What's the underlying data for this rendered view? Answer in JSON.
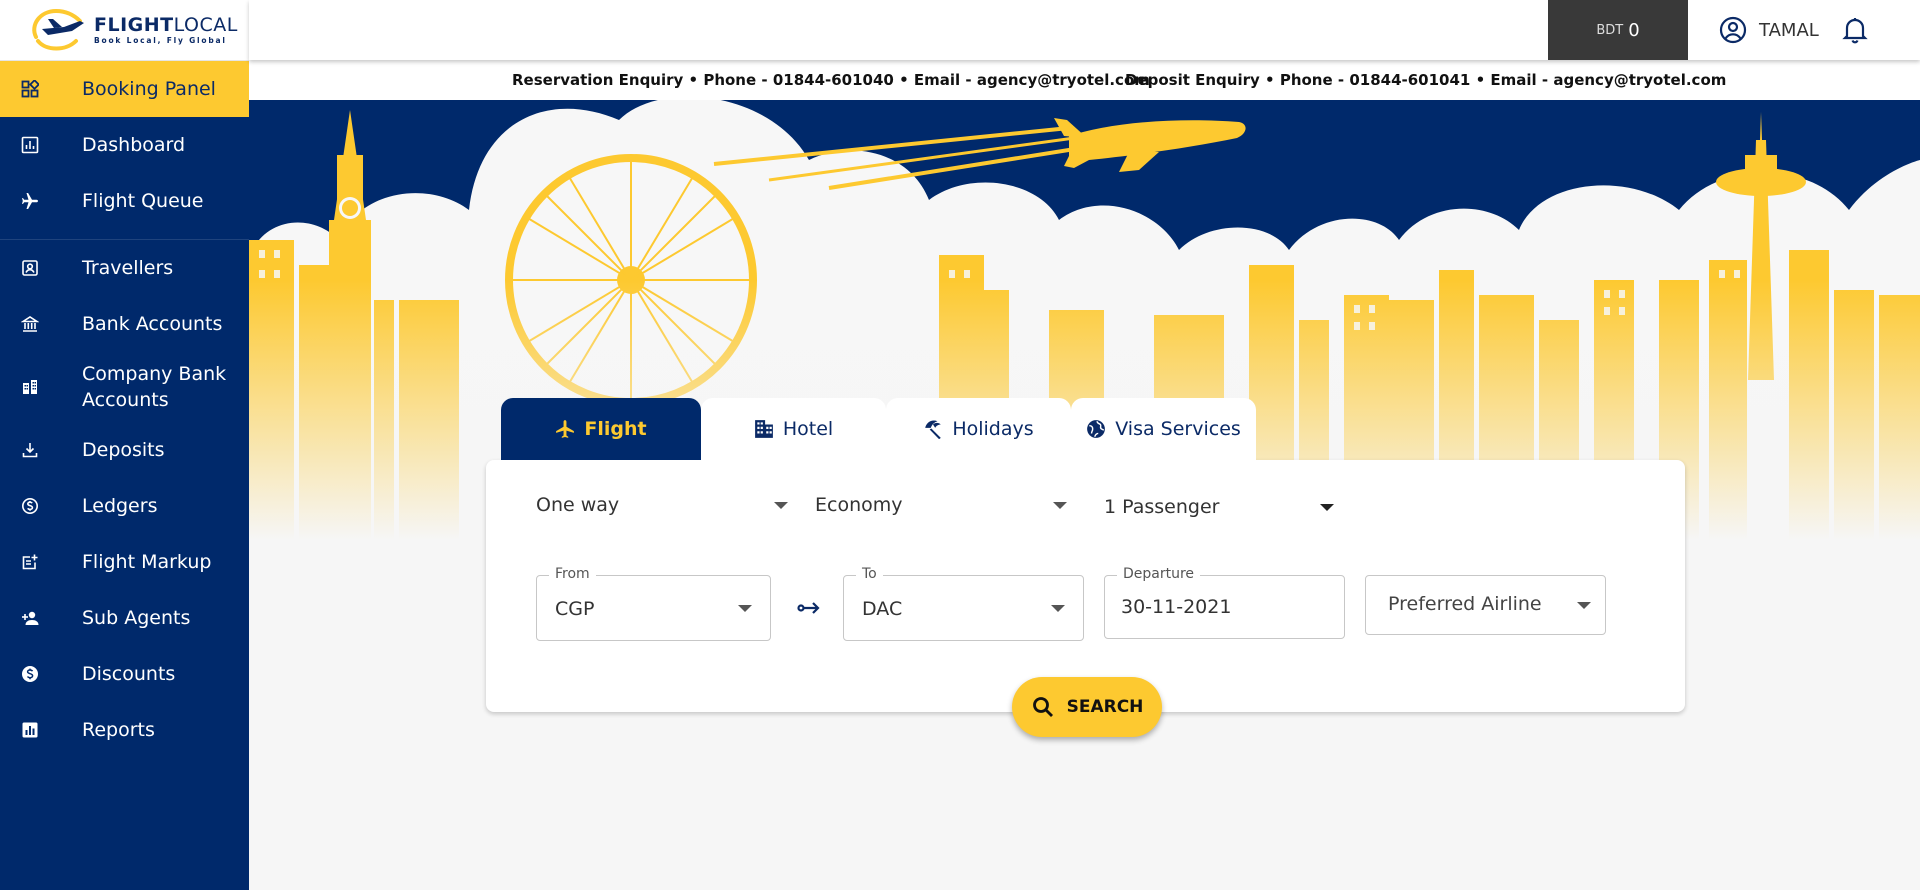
{
  "brand": {
    "name_bold": "FLIGHT",
    "name_light": "LOCAL",
    "tagline": "Book Local, Fly Global"
  },
  "sidebar": {
    "items": [
      {
        "label": "Booking Panel",
        "icon": "grid-icon",
        "active": true
      },
      {
        "label": "Dashboard",
        "icon": "chart-icon"
      },
      {
        "label": "Flight Queue",
        "icon": "airplane-icon"
      },
      {
        "label": "Travellers",
        "icon": "contact-card-icon"
      },
      {
        "label": "Bank Accounts",
        "icon": "bank-icon"
      },
      {
        "label": "Company Bank Accounts",
        "icon": "building-icon"
      },
      {
        "label": "Deposits",
        "icon": "download-icon"
      },
      {
        "label": "Ledgers",
        "icon": "currency-icon"
      },
      {
        "label": "Flight Markup",
        "icon": "edit-note-icon"
      },
      {
        "label": "Sub Agents",
        "icon": "person-add-icon"
      },
      {
        "label": "Discounts",
        "icon": "dollar-icon"
      },
      {
        "label": "Reports",
        "icon": "report-icon"
      }
    ]
  },
  "header": {
    "balance_currency": "BDT",
    "balance_amount": "0",
    "user_name": "TAMAL"
  },
  "enquiry": {
    "reservation": "Reservation Enquiry • Phone - 01844-601040 • Email - agency@tryotel.com",
    "deposit": "Deposit Enquiry • Phone - 01844-601041 • Email - agency@tryotel.com"
  },
  "tabs": [
    {
      "label": "Flight",
      "icon": "airplane-icon",
      "active": true
    },
    {
      "label": "Hotel",
      "icon": "hotel-icon"
    },
    {
      "label": "Holidays",
      "icon": "beach-icon"
    },
    {
      "label": "Visa Services",
      "icon": "globe-icon"
    }
  ],
  "search": {
    "trip_type": "One way",
    "cabin_class": "Economy",
    "passengers": "1 Passenger",
    "from_label": "From",
    "from_value": "CGP",
    "to_label": "To",
    "to_value": "DAC",
    "departure_label": "Departure",
    "departure_value": "30-11-2021",
    "airline_placeholder": "Preferred Airline",
    "search_label": "SEARCH"
  },
  "colors": {
    "navy": "#00296b",
    "yellow": "#fdc930",
    "dark": "#393939"
  }
}
